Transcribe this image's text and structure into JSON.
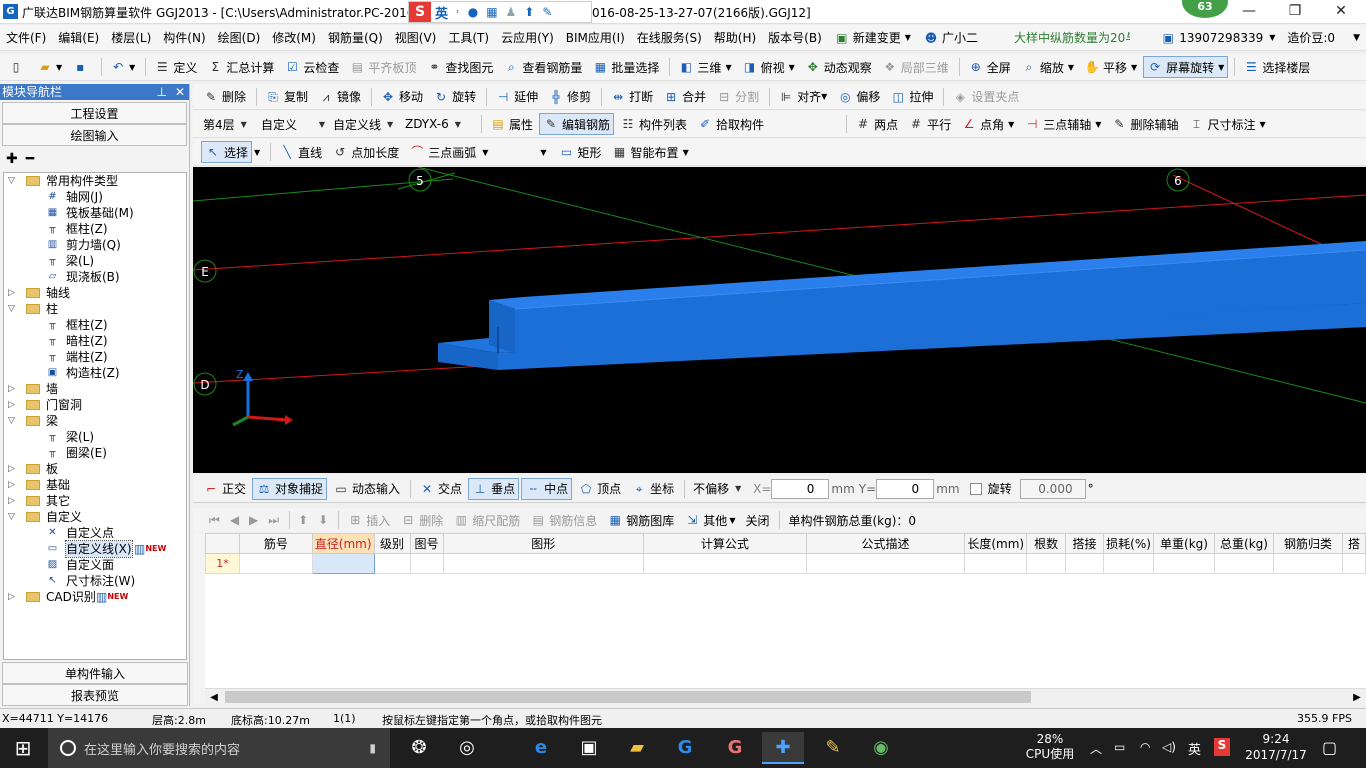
{
  "window": {
    "title": "广联达BIM钢筋算量软件 GGJ2013 - [C:\\Users\\Administrator.PC-2016-",
    "title_tail": "016-08-25-13-27-07(2166版).GGJ12]",
    "badge": "63",
    "ime_label": "英",
    "minimize": "—",
    "restore": "❐",
    "close": "✕"
  },
  "menu": {
    "items": [
      "文件(F)",
      "编辑(E)",
      "楼层(L)",
      "构件(N)",
      "绘图(D)",
      "修改(M)",
      "钢筋量(Q)",
      "视图(V)",
      "工具(T)",
      "云应用(Y)",
      "BIM应用(I)",
      "在线服务(S)",
      "帮助(H)",
      "版本号(B)"
    ],
    "new_change": "新建变更",
    "assistant": "广小二",
    "notice": "大样中纵筋数量为20与...",
    "phone": "13907298339",
    "price_bean": "造价豆:0"
  },
  "toolbar1": [
    "定义",
    "汇总计算",
    "云检查",
    "平齐板顶",
    "查找图元",
    "查看钢筋量",
    "批量选择",
    "三维",
    "俯视",
    "动态观察",
    "局部三维",
    "全屏",
    "缩放",
    "平移",
    "屏幕旋转",
    "选择楼层"
  ],
  "toolbar2": [
    "删除",
    "复制",
    "镜像",
    "移动",
    "旋转",
    "延伸",
    "修剪",
    "打断",
    "合并",
    "分割",
    "对齐",
    "偏移",
    "拉伸",
    "设置夹点"
  ],
  "toolbar3": {
    "floor": "第4层",
    "category": "自定义",
    "type": "自定义线",
    "component": "ZDYX-6",
    "buttons": [
      "属性",
      "编辑钢筋",
      "构件列表",
      "拾取构件"
    ],
    "right_buttons": [
      "两点",
      "平行",
      "点角",
      "三点辅轴",
      "删除辅轴",
      "尺寸标注"
    ]
  },
  "toolbar4": [
    "选择",
    "直线",
    "点加长度",
    "三点画弧",
    "矩形",
    "智能布置"
  ],
  "left_panel": {
    "title": "模块导航栏",
    "pin": "ꟸ",
    "close": "✕",
    "btn_project": "工程设置",
    "btn_draw": "绘图输入",
    "btn_single": "单构件输入",
    "btn_report": "报表预览",
    "tree": [
      {
        "label": "常用构件类型",
        "level": 0,
        "expand": "−",
        "folder": true
      },
      {
        "label": "轴网(J)",
        "level": 1,
        "icon": "#"
      },
      {
        "label": "筏板基础(M)",
        "level": 1,
        "icon": "▦"
      },
      {
        "label": "框柱(Z)",
        "level": 1,
        "icon": "╥"
      },
      {
        "label": "剪力墙(Q)",
        "level": 1,
        "icon": "▥"
      },
      {
        "label": "梁(L)",
        "level": 1,
        "icon": "╥"
      },
      {
        "label": "现浇板(B)",
        "level": 1,
        "icon": "▱"
      },
      {
        "label": "轴线",
        "level": 0,
        "expand": "+",
        "folder": true
      },
      {
        "label": "柱",
        "level": 0,
        "expand": "−",
        "folder": true
      },
      {
        "label": "框柱(Z)",
        "level": 1,
        "icon": "╥"
      },
      {
        "label": "暗柱(Z)",
        "level": 1,
        "icon": "╥"
      },
      {
        "label": "端柱(Z)",
        "level": 1,
        "icon": "╥"
      },
      {
        "label": "构造柱(Z)",
        "level": 1,
        "icon": "▣"
      },
      {
        "label": "墙",
        "level": 0,
        "expand": "+",
        "folder": true
      },
      {
        "label": "门窗洞",
        "level": 0,
        "expand": "+",
        "folder": true
      },
      {
        "label": "梁",
        "level": 0,
        "expand": "−",
        "folder": true
      },
      {
        "label": "梁(L)",
        "level": 1,
        "icon": "╥"
      },
      {
        "label": "圈梁(E)",
        "level": 1,
        "icon": "╥"
      },
      {
        "label": "板",
        "level": 0,
        "expand": "+",
        "folder": true
      },
      {
        "label": "基础",
        "level": 0,
        "expand": "+",
        "folder": true
      },
      {
        "label": "其它",
        "level": 0,
        "expand": "+",
        "folder": true
      },
      {
        "label": "自定义",
        "level": 0,
        "expand": "−",
        "folder": true
      },
      {
        "label": "自定义点",
        "level": 1,
        "icon": "✕"
      },
      {
        "label": "自定义线(X)",
        "level": 1,
        "icon": "▭",
        "new": "NEW",
        "selected": true
      },
      {
        "label": "自定义面",
        "level": 1,
        "icon": "▨"
      },
      {
        "label": "尺寸标注(W)",
        "level": 1,
        "icon": "↖"
      },
      {
        "label": "CAD识别",
        "level": 0,
        "expand": "+",
        "folder": true,
        "new": "NEW"
      }
    ]
  },
  "viewport": {
    "axis_labels": [
      "5",
      "6",
      "E",
      "D"
    ],
    "z_label": "Z"
  },
  "snapbar": {
    "items": [
      "正交",
      "对象捕捉",
      "动态输入",
      "交点",
      "垂点",
      "中点",
      "顶点",
      "坐标"
    ],
    "offset": "不偏移",
    "x_label": "X=",
    "x_value": "0",
    "mm1": "mm",
    "y_label": "Y=",
    "y_value": "0",
    "mm2": "mm",
    "rotate_label": "旋转",
    "rotate_value": "0.000",
    "deg": "°"
  },
  "gridbar": {
    "buttons": [
      "插入",
      "删除",
      "缩尺配筋",
      "钢筋信息",
      "钢筋图库",
      "其他",
      "关闭"
    ],
    "total": "单构件钢筋总重(kg)：0"
  },
  "grid": {
    "headers": [
      "",
      "筋号",
      "直径(mm)",
      "级别",
      "图号",
      "图形",
      "计算公式",
      "公式描述",
      "长度(mm)",
      "根数",
      "搭接",
      "损耗(%)",
      "单重(kg)",
      "总重(kg)",
      "钢筋归类",
      "搭"
    ],
    "row1": "1*"
  },
  "status": {
    "coords": "X=44711 Y=14176",
    "floor_height": "层高:2.8m",
    "bottom_height": "底标高:10.27m",
    "count": "1(1)",
    "hint": "按鼠标左键指定第一个角点，或拾取构件图元",
    "fps": "355.9 FPS"
  },
  "taskbar": {
    "search": "在这里输入你要搜索的内容",
    "cpu_pct": "28%",
    "cpu_label": "CPU使用",
    "ime": "英",
    "time": "9:24",
    "date": "2017/7/17"
  },
  "colors": {
    "beam": "#1c6fd6",
    "axis_red": "#d21818",
    "axis_green": "#1a8a1a",
    "accent": "#3c78c8"
  }
}
